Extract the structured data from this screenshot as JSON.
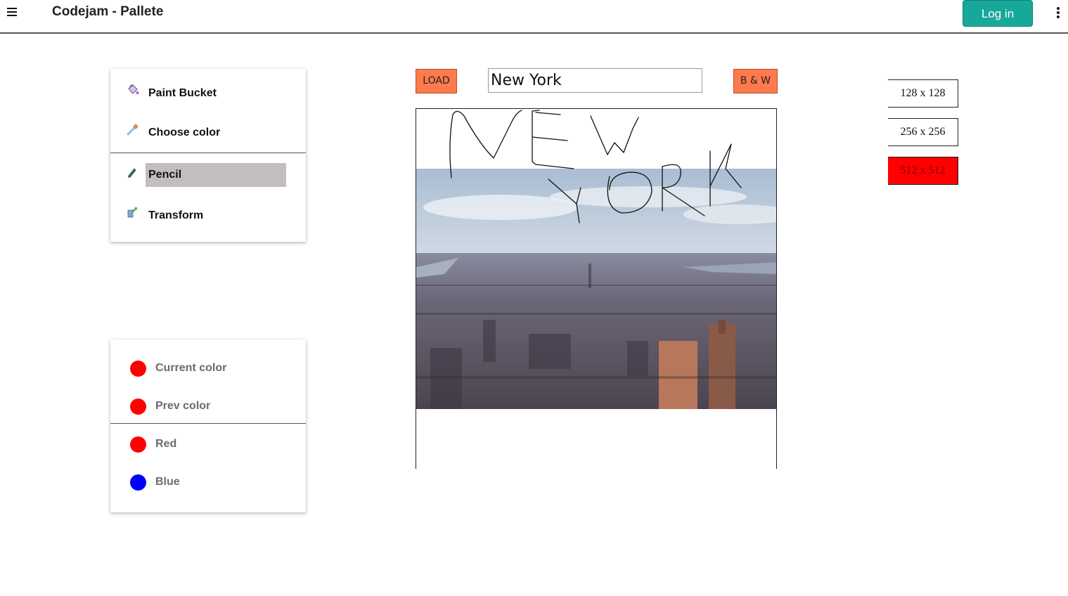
{
  "header": {
    "title": "Codejam - Pallete",
    "login_label": "Log in"
  },
  "tools": {
    "items": [
      {
        "label": "Paint Bucket",
        "icon": "paint-bucket-icon"
      },
      {
        "label": "Choose color",
        "icon": "eyedropper-icon"
      },
      {
        "label": "Pencil",
        "icon": "pencil-icon",
        "active": true
      },
      {
        "label": "Transform",
        "icon": "transform-icon"
      }
    ]
  },
  "colors": {
    "current": {
      "label": "Current color",
      "color": "#ff0000"
    },
    "prev": {
      "label": "Prev color",
      "color": "#ff0000"
    },
    "presets": [
      {
        "label": "Red",
        "color": "#ff0000"
      },
      {
        "label": "Blue",
        "color": "#0000ff"
      }
    ]
  },
  "image_loader": {
    "load_label": "LOAD",
    "city_value": "New York",
    "bw_label": "B & W"
  },
  "canvas": {
    "image": "new-york-skyline-photo",
    "drawing": "NEW YORK"
  },
  "sizes": [
    {
      "label": "128 x 128"
    },
    {
      "label": "256 x 256"
    },
    {
      "label": "512 x 512",
      "active": true
    }
  ],
  "accent_colors": {
    "primary": "#17a89a",
    "button": "#ff7a4d",
    "selected_size": "#ff0000",
    "active_tool": "#c2bebe"
  }
}
